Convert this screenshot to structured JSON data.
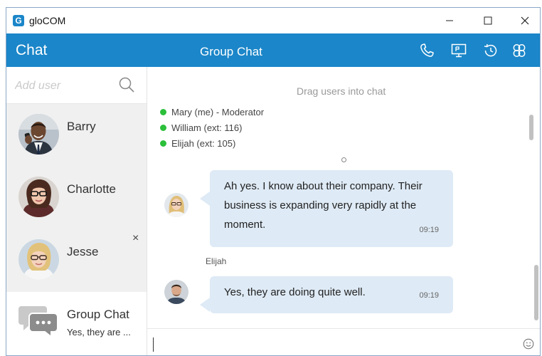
{
  "window": {
    "app_title": "gloCOM",
    "logo_letter": "G",
    "controls": {
      "minimize_icon": "minimize-icon",
      "maximize_icon": "maximize-icon",
      "close_icon": "close-icon"
    }
  },
  "header": {
    "section_title": "Chat",
    "chat_title": "Group Chat",
    "actions": [
      "phone-icon",
      "screen-share-icon",
      "history-icon",
      "participants-icon"
    ],
    "background_color": "#1b86c9"
  },
  "sidebar": {
    "search_placeholder": "Add user",
    "contacts": [
      {
        "name": "Barry"
      },
      {
        "name": "Charlotte"
      },
      {
        "name": "Jesse",
        "close_glyph": "×"
      }
    ],
    "group_chat": {
      "name": "Group Chat",
      "last_message": "Yes, they are ..."
    }
  },
  "chat": {
    "drag_hint": "Drag users into chat",
    "participants": [
      {
        "label": "Mary (me) - Moderator",
        "status_color": "#2bbf3a"
      },
      {
        "label": "William (ext: 116)",
        "status_color": "#2bbf3a"
      },
      {
        "label": "Elijah (ext: 105)",
        "status_color": "#2bbf3a"
      }
    ],
    "messages": [
      {
        "sender": "",
        "lines": [
          "Ah yes. I know about their company. Their",
          "business is expanding very rapidly at the",
          "moment."
        ],
        "time": "09:19"
      },
      {
        "sender": "Elijah",
        "lines": [
          "Yes, they are doing quite well."
        ],
        "time": "09:19"
      }
    ],
    "composer_value": "",
    "bubble_color": "#deeaf5"
  }
}
